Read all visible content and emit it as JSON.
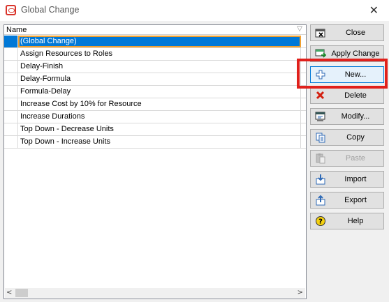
{
  "window": {
    "title": "Global Change",
    "close_glyph": "✕"
  },
  "list": {
    "column_header": "Name",
    "sort_icon": "▽",
    "items": [
      {
        "label": "(Global Change)",
        "selected": true
      },
      {
        "label": "Assign Resources to Roles",
        "selected": false
      },
      {
        "label": "Delay-Finish",
        "selected": false
      },
      {
        "label": "Delay-Formula",
        "selected": false
      },
      {
        "label": "Formula-Delay",
        "selected": false
      },
      {
        "label": "Increase Cost by 10% for Resource",
        "selected": false
      },
      {
        "label": "Increase Durations",
        "selected": false
      },
      {
        "label": "Top Down - Decrease Units",
        "selected": false
      },
      {
        "label": "Top Down - Increase Units",
        "selected": false
      }
    ]
  },
  "scrollbar": {
    "left_arrow": "<",
    "right_arrow": ">"
  },
  "buttons": [
    {
      "label": "Close",
      "icon": "close-dialog-icon",
      "enabled": true
    },
    {
      "label": "Apply Change",
      "icon": "apply-change-icon",
      "enabled": true
    },
    {
      "label": "New...",
      "icon": "new-plus-icon",
      "enabled": true
    },
    {
      "label": "Delete",
      "icon": "delete-x-icon",
      "enabled": true
    },
    {
      "label": "Modify...",
      "icon": "modify-icon",
      "enabled": true
    },
    {
      "label": "Copy",
      "icon": "copy-icon",
      "enabled": true
    },
    {
      "label": "Paste",
      "icon": "paste-icon",
      "enabled": false
    },
    {
      "label": "Import",
      "icon": "import-icon",
      "enabled": true
    },
    {
      "label": "Export",
      "icon": "export-icon",
      "enabled": true
    },
    {
      "label": "Help",
      "icon": "help-icon",
      "enabled": true
    }
  ],
  "colors": {
    "selection": "#0078d7",
    "annotation": "#e0201b",
    "brand": "#d9342b"
  }
}
